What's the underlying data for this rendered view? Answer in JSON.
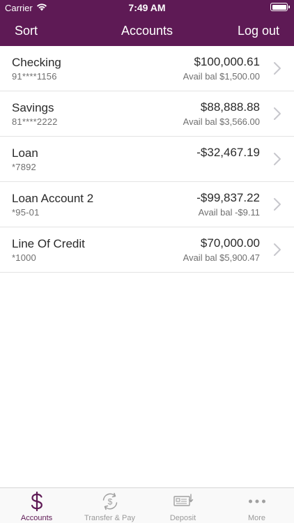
{
  "status": {
    "carrier": "Carrier",
    "time": "7:49 AM"
  },
  "nav": {
    "sort": "Sort",
    "title": "Accounts",
    "logout": "Log out"
  },
  "accounts": [
    {
      "name": "Checking",
      "number": "91****1156",
      "balance": "$100,000.61",
      "avail": "Avail bal $1,500.00"
    },
    {
      "name": "Savings",
      "number": "81****2222",
      "balance": "$88,888.88",
      "avail": "Avail bal $3,566.00"
    },
    {
      "name": "Loan",
      "number": "*7892",
      "balance": "-$32,467.19",
      "avail": ""
    },
    {
      "name": "Loan Account 2",
      "number": "*95-01",
      "balance": "-$99,837.22",
      "avail": "Avail bal -$9.11"
    },
    {
      "name": "Line Of Credit",
      "number": "*1000",
      "balance": "$70,000.00",
      "avail": "Avail bal $5,900.47"
    }
  ],
  "tabs": [
    {
      "label": "Accounts",
      "icon": "dollar-icon",
      "active": true
    },
    {
      "label": "Transfer & Pay",
      "icon": "transfer-icon",
      "active": false
    },
    {
      "label": "Deposit",
      "icon": "check-deposit-icon",
      "active": false
    },
    {
      "label": "More",
      "icon": "more-icon",
      "active": false
    }
  ],
  "colors": {
    "brand": "#5e1a55",
    "tab_inactive": "#9a9a9a"
  }
}
